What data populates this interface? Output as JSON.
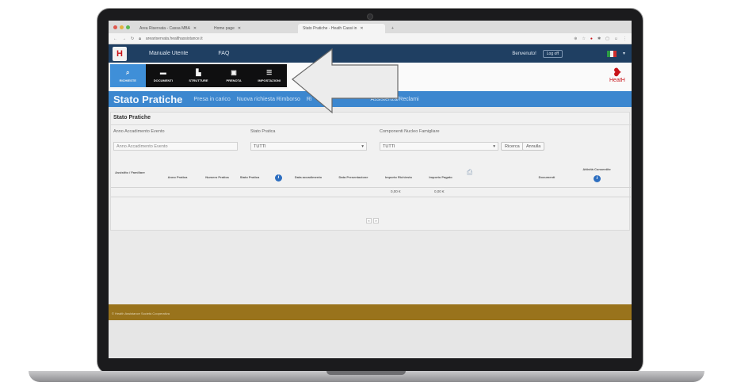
{
  "browser": {
    "tabs": [
      {
        "label": "Area Riservata - Cassa MBA",
        "active": false
      },
      {
        "label": "Home page",
        "active": false
      },
      {
        "label": "Stato Pratiche - Heath Cassi in",
        "active": true
      }
    ],
    "new_tab": "+",
    "url": "areariservata.healthassistance.it",
    "window_dot_colors": [
      "#e0594f",
      "#e3b23f",
      "#5bb952"
    ]
  },
  "app_nav": {
    "logo": "H",
    "links": [
      "Manuale Utente",
      "FAQ"
    ],
    "welcome": "Benvenuto!",
    "logoff": "Log off",
    "flag_colors": [
      "#2e9b45",
      "#f0f0f0",
      "#cf2b2b"
    ]
  },
  "brand": {
    "name": "HeatH"
  },
  "popup_menu": {
    "items": [
      {
        "label": "RICHIESTE",
        "icon": "magnifier-icon",
        "selected": true
      },
      {
        "label": "DOCUMENTI",
        "icon": "document-icon",
        "selected": false
      },
      {
        "label": "STRUTTURE",
        "icon": "building-icon",
        "selected": false
      },
      {
        "label": "PRENOTA",
        "icon": "calendar-icon",
        "selected": false
      },
      {
        "label": "IMPOSTAZIONI",
        "icon": "list-icon",
        "selected": false
      }
    ]
  },
  "subnav": {
    "title": "Stato Pratiche",
    "links": [
      "Presa in carico",
      "Nuova richiesta Rimborso",
      "Ri",
      "Assistenza/Reclami"
    ]
  },
  "panel": {
    "title": "Stato Pratiche",
    "filters": {
      "anno_label": "Anno Accadimento Evento",
      "anno_placeholder": "Anno Accadimento Evento",
      "stato_label": "Stato Pratica",
      "stato_value": "TUTTI",
      "componenti_label": "Componenti Nucleo Famigliare",
      "componenti_value": "TUTTI",
      "search_button": "Ricerca",
      "cancel_button": "Annulla"
    },
    "columns": [
      "Assistito / Familiare",
      "Anno Pratica",
      "Numero Pratica",
      "Stato Pratica",
      "Data accadimento",
      "Data Presentazione",
      "Importo Richiesto",
      "Importo Pagato",
      "Documenti",
      "Attività Consentite"
    ],
    "totals": {
      "importo_richiesto": "0,00 €",
      "importo_pagato": "0,00 €"
    },
    "pager": [
      "«",
      "»"
    ]
  },
  "footer": {
    "text": "© Health Assistance Società Cooperativa"
  }
}
